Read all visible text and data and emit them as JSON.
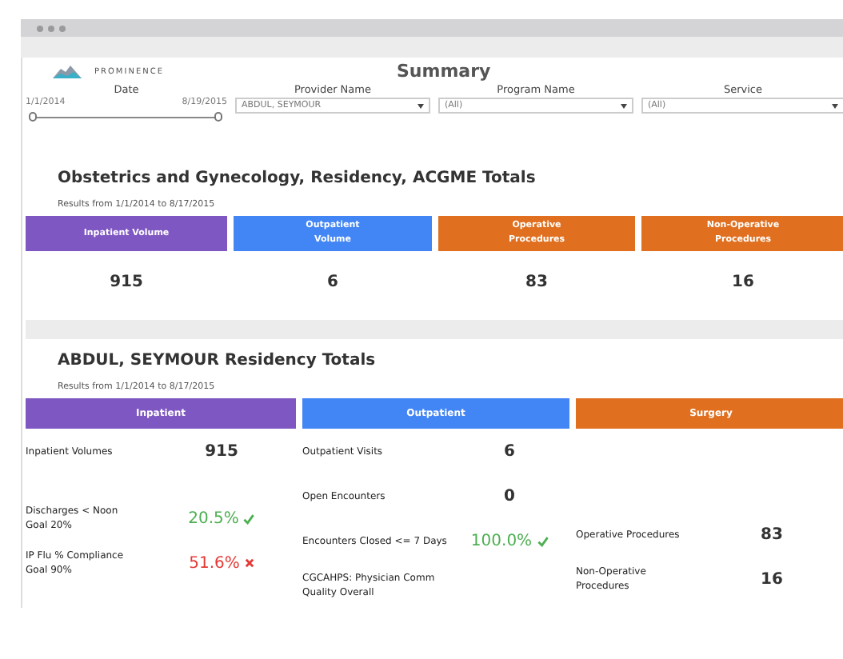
{
  "header": {
    "logo_text": "PROMINENCE",
    "title": "Summary"
  },
  "filters": {
    "date": {
      "label": "Date",
      "start": "1/1/2014",
      "end": "8/19/2015",
      "level": 1
    },
    "dropdowns": [
      {
        "label": "Provider Name",
        "value": "ABDUL, SEYMOUR"
      },
      {
        "label": "Program Name",
        "value": "(All)"
      },
      {
        "label": "Service",
        "value": "(All)"
      }
    ]
  },
  "program_totals": {
    "title": "Obstetrics and Gynecology, Residency, ACGME Totals",
    "subtitle": "Results from 1/1/2014 to 8/17/2015",
    "cards": [
      {
        "label": "Inpatient Volume",
        "value": "915",
        "color": "#7e57c2"
      },
      {
        "label": "Outpatient Volume",
        "value": "6",
        "color": "#4285f4"
      },
      {
        "label": "Operative Procedures",
        "value": "83",
        "color": "#e07020"
      },
      {
        "label": "Non-Operative Procedures",
        "value": "16",
        "color": "#e07020"
      }
    ]
  },
  "resident_totals": {
    "title": "ABDUL, SEYMOUR Residency Totals",
    "subtitle": "Results from 1/1/2014 to 8/17/2015",
    "columns": [
      {
        "header": "Inpatient",
        "color": "#7e57c2",
        "metrics": [
          {
            "label": "Inpatient Volumes",
            "value": "915"
          },
          {
            "label": "Discharges < Noon",
            "goal": "Goal 20%",
            "value": "20.5%",
            "goal_met": true
          },
          {
            "label": "IP Flu % Compliance",
            "goal": "Goal 90%",
            "value": "51.6%",
            "goal_met": false
          }
        ]
      },
      {
        "header": "Outpatient",
        "color": "#4285f4",
        "metrics": [
          {
            "label": "Outpatient Visits",
            "value": "6"
          },
          {
            "label": "Open Encounters",
            "value": "0"
          },
          {
            "label": "Encounters Closed <= 7 Days",
            "value": "100.0%",
            "goal_met": true
          },
          {
            "label": "CGCAHPS: Physician Comm",
            "goal": "Quality Overall"
          }
        ]
      },
      {
        "header": "Surgery",
        "color": "#e07020",
        "metrics": [
          {
            "label": "Operative Procedures",
            "value": "83"
          },
          {
            "label": "Non-Operative Procedures",
            "value": "16"
          }
        ]
      }
    ]
  }
}
